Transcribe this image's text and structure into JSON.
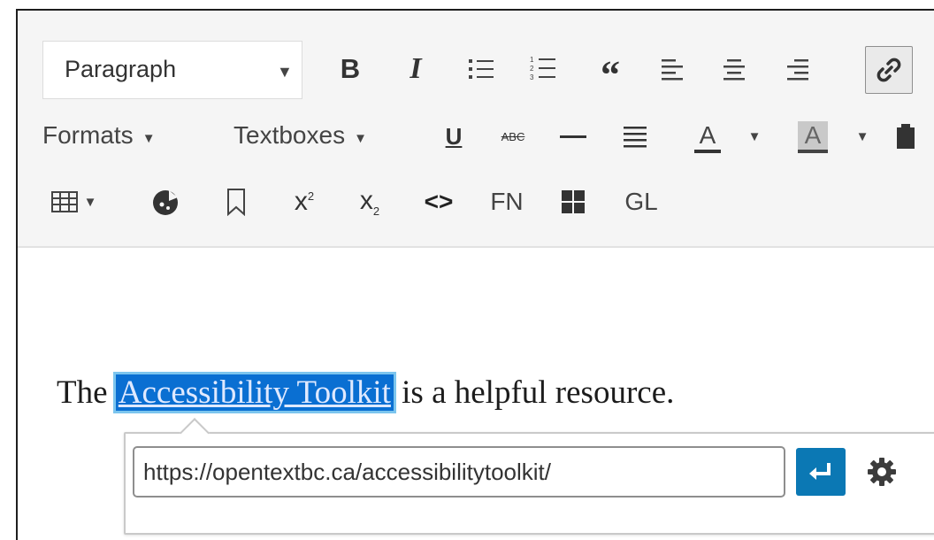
{
  "toolbar": {
    "format_select": "Paragraph",
    "formats_label": "Formats",
    "textboxes_label": "Textboxes",
    "fn_label": "FN",
    "gl_label": "GL"
  },
  "editor": {
    "before": "The ",
    "selected": "Accessibility Toolkit",
    "after": " is a helpful resource."
  },
  "link_popover": {
    "url": "https://opentextbc.ca/accessibilitytoolkit/"
  },
  "colors": {
    "apply_button": "#0b78b4",
    "selection": "#0a6fd2"
  },
  "icons": [
    "bold-icon",
    "italic-icon",
    "bulleted-list-icon",
    "numbered-list-icon",
    "blockquote-icon",
    "align-left-icon",
    "align-center-icon",
    "align-right-icon",
    "link-icon",
    "underline-icon",
    "strikethrough-icon",
    "horizontal-rule-icon",
    "justify-icon",
    "text-color-icon",
    "background-color-icon",
    "paste-icon",
    "table-icon",
    "special-character-icon",
    "bookmark-icon",
    "superscript-icon",
    "subscript-icon",
    "code-icon",
    "glossary-grid-icon",
    "enter-icon",
    "gear-icon"
  ]
}
